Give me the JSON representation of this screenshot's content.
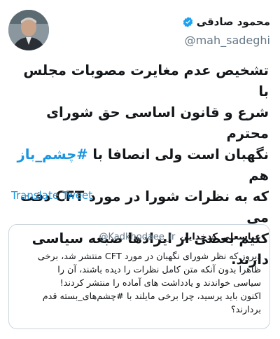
{
  "author": {
    "display_name": "محمود صادقی",
    "handle": "@mah_sadeghi"
  },
  "tweet": {
    "text_before_hashtag": "تشخیص عدم مغایرت مصوبات مجلس با\nشرع و قانون اساسی حق شورای محترم\nنگهبان است ولی انصافا با ",
    "hashtag": "#چشم_باز",
    "text_after_hashtag": " هم\nکه به نظرات شورا در مورد CFT دقت می\nکنیم بعضی از ایرادها صبغه سیاسی دارند."
  },
  "translate_label": "Translate Tweet",
  "quoted": {
    "display_name": "عباسعلی کدخدایی",
    "handle": "@Kadkhodaee_ir",
    "text": "دیروز که نظر شورای نگهبان در مورد CFT منتشر شد، برخی\nظاهرا بدون آنکه متن کامل نظرات را دیده باشند، آن را\nسیاسی خواندند و یادداشت های آماده را منتشر کردند!\nاکنون باید پرسید، چرا برخی مایلند با #چشم‌های_بسته قدم\nبردارند؟"
  },
  "colors": {
    "link": "#1b95e0",
    "verified": "#1da1f2",
    "muted": "#657786",
    "border": "#ccd6dd"
  }
}
